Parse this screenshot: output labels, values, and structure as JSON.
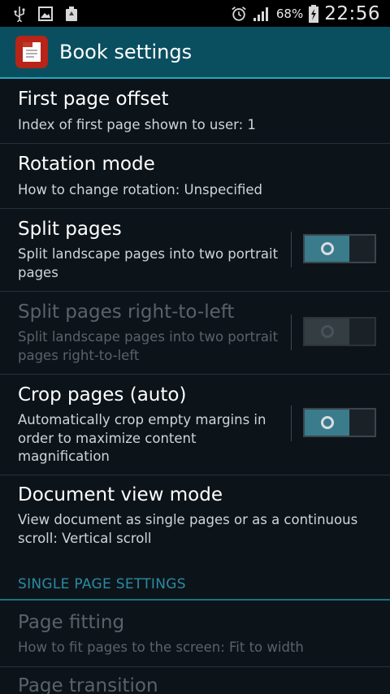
{
  "status_bar": {
    "battery_percent": "68%",
    "time": "22:56",
    "icons_left": [
      "usb-icon",
      "image-icon",
      "recycle-icon"
    ],
    "icons_right": [
      "alarm-icon",
      "signal-icon",
      "battery-charging-icon"
    ]
  },
  "action_bar": {
    "title": "Book settings",
    "app_icon": "pdf-reader-app-icon"
  },
  "settings": [
    {
      "title": "First page offset",
      "summary": "Index of first page shown to user: 1"
    },
    {
      "title": "Rotation mode",
      "summary": "How to change rotation: Unspecified"
    },
    {
      "title": "Split pages",
      "summary": "Split landscape pages into two portrait pages",
      "toggle": "off",
      "enabled": true
    },
    {
      "title": "Split pages right-to-left",
      "summary": "Split landscape pages into two portrait pages right-to-left",
      "toggle": "off",
      "enabled": false
    },
    {
      "title": "Crop pages (auto)",
      "summary": "Automatically crop empty margins in order to maximize content magnification",
      "toggle": "off",
      "enabled": true
    },
    {
      "title": "Document view mode",
      "summary": "View document as single pages or as a continuous scroll: Vertical scroll"
    }
  ],
  "section": {
    "header": "SINGLE PAGE SETTINGS",
    "items": [
      {
        "title": "Page fitting",
        "summary": "How to fit pages to the screen: Fit to width",
        "enabled": false
      },
      {
        "title": "Page transition",
        "enabled": false
      }
    ]
  },
  "colors": {
    "action_bar": "#0a4f60",
    "accent": "#2c8aa1",
    "toggle_thumb": "#3a7b8c"
  }
}
